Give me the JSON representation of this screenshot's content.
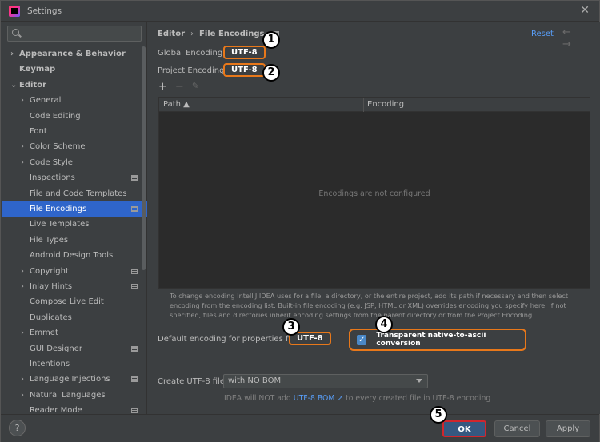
{
  "window": {
    "title": "Settings",
    "close_symbol": "✕"
  },
  "sidebar": {
    "search_placeholder": "",
    "items": [
      {
        "label": "Appearance & Behavior",
        "bold": true,
        "expander": "right",
        "indent": 0
      },
      {
        "label": "Keymap",
        "bold": true,
        "expander": "none",
        "indent": 0
      },
      {
        "label": "Editor",
        "bold": true,
        "expander": "down",
        "indent": 0
      },
      {
        "label": "General",
        "expander": "right",
        "indent": 1
      },
      {
        "label": "Code Editing",
        "indent": 1
      },
      {
        "label": "Font",
        "indent": 1
      },
      {
        "label": "Color Scheme",
        "expander": "right",
        "indent": 1
      },
      {
        "label": "Code Style",
        "expander": "right",
        "indent": 1
      },
      {
        "label": "Inspections",
        "indent": 1,
        "project_icon": true
      },
      {
        "label": "File and Code Templates",
        "indent": 1
      },
      {
        "label": "File Encodings",
        "indent": 1,
        "selected": true,
        "project_icon": true
      },
      {
        "label": "Live Templates",
        "indent": 1
      },
      {
        "label": "File Types",
        "indent": 1
      },
      {
        "label": "Android Design Tools",
        "indent": 1
      },
      {
        "label": "Copyright",
        "expander": "right",
        "indent": 1,
        "project_icon": true
      },
      {
        "label": "Inlay Hints",
        "expander": "right",
        "indent": 1,
        "project_icon": true
      },
      {
        "label": "Compose Live Edit",
        "indent": 1
      },
      {
        "label": "Duplicates",
        "indent": 1
      },
      {
        "label": "Emmet",
        "expander": "right",
        "indent": 1
      },
      {
        "label": "GUI Designer",
        "indent": 1,
        "project_icon": true
      },
      {
        "label": "Intentions",
        "indent": 1
      },
      {
        "label": "Language Injections",
        "expander": "right",
        "indent": 1,
        "project_icon": true
      },
      {
        "label": "Natural Languages",
        "expander": "right",
        "indent": 1
      },
      {
        "label": "Reader Mode",
        "indent": 1,
        "project_icon": true
      }
    ]
  },
  "header": {
    "breadcrumb_parent": "Editor",
    "breadcrumb_separator": "›",
    "breadcrumb_current": "File Encodings",
    "reset_label": "Reset",
    "nav_arrows": "← →"
  },
  "global_encoding": {
    "label": "Global Encoding:",
    "value": "UTF-8"
  },
  "project_encoding": {
    "label": "Project Encoding:",
    "value": "UTF-8"
  },
  "table": {
    "toolbar": {
      "add": "+",
      "remove": "−",
      "edit": "✎"
    },
    "columns": [
      "Path ▲",
      "Encoding"
    ],
    "empty_text": "Encodings are not configured"
  },
  "help_text": "To change encoding IntelliJ IDEA uses for a file, a directory, or the entire project, add its path if necessary and then select encoding from the encoding list. Built-in file encoding (e.g. JSP, HTML or XML) overrides encoding you specify here. If not specified, files and directories inherit encoding settings from the parent directory or from the Project Encoding.",
  "properties": {
    "label": "Default encoding for properties files:",
    "value": "UTF-8"
  },
  "native_to_ascii": {
    "label": "Transparent native-to-ascii conversion",
    "checked": true,
    "check_symbol": "✓"
  },
  "utf8_bom": {
    "label": "Create UTF-8 files:",
    "selected": "with NO BOM",
    "note_prefix": "IDEA will NOT add",
    "note_link": "UTF-8 BOM ↗",
    "note_suffix": "to every created file in UTF-8 encoding"
  },
  "footer": {
    "help": "?",
    "ok": "OK",
    "cancel": "Cancel",
    "apply": "Apply"
  },
  "annotations": [
    "1",
    "2",
    "3",
    "4",
    "5"
  ],
  "colors": {
    "accent": "#2f65ca",
    "highlight": "#e8781a",
    "ok_border": "#d0262d",
    "link": "#589df6"
  }
}
